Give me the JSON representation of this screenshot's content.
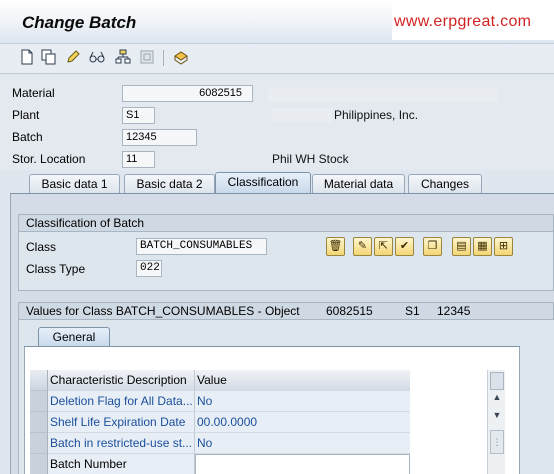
{
  "window": {
    "title": "Change Batch",
    "watermark": "www.erpgreat.com"
  },
  "toolbar": {
    "icons": [
      "new-document-icon",
      "copy-icon",
      "edit-pencil-icon",
      "glasses-display-icon",
      "hierarchy-icon",
      "disabled-icon",
      "stock-overview-icon"
    ]
  },
  "header": {
    "material_label": "Material",
    "material_value": "6082515",
    "plant_label": "Plant",
    "plant_value": "S1",
    "plant_desc": "Philippines, Inc.",
    "batch_label": "Batch",
    "batch_value": "12345",
    "sloc_label": "Stor. Location",
    "sloc_value": "11",
    "sloc_desc": "Phil WH Stock"
  },
  "tabs": [
    {
      "label": "Basic data 1",
      "active": false
    },
    {
      "label": "Basic data 2",
      "active": false
    },
    {
      "label": "Classification",
      "active": true
    },
    {
      "label": "Material data",
      "active": false
    },
    {
      "label": "Changes",
      "active": false
    }
  ],
  "classification": {
    "group_title": "Classification of Batch",
    "class_label": "Class",
    "class_value": "BATCH_CONSUMABLES",
    "class_type_label": "Class Type",
    "class_type_value": "022"
  },
  "values": {
    "group_title": "Values for Class BATCH_CONSUMABLES - Object",
    "object_material": "6082515",
    "object_plant": "S1",
    "object_batch": "12345",
    "inner_tab": "General",
    "columns": [
      "Characteristic Description",
      "Value"
    ],
    "rows": [
      {
        "description": "Deletion Flag for All Data...",
        "value": "No"
      },
      {
        "description": "Shelf Life Expiration Date",
        "value": "00.00.0000"
      },
      {
        "description": "Batch in restricted-use st...",
        "value": "No"
      },
      {
        "description": "Batch Number",
        "value": ""
      }
    ]
  },
  "colors": {
    "watermark": "#d12323",
    "link_text": "#1a4f9c",
    "background": "#dfe6ee"
  }
}
